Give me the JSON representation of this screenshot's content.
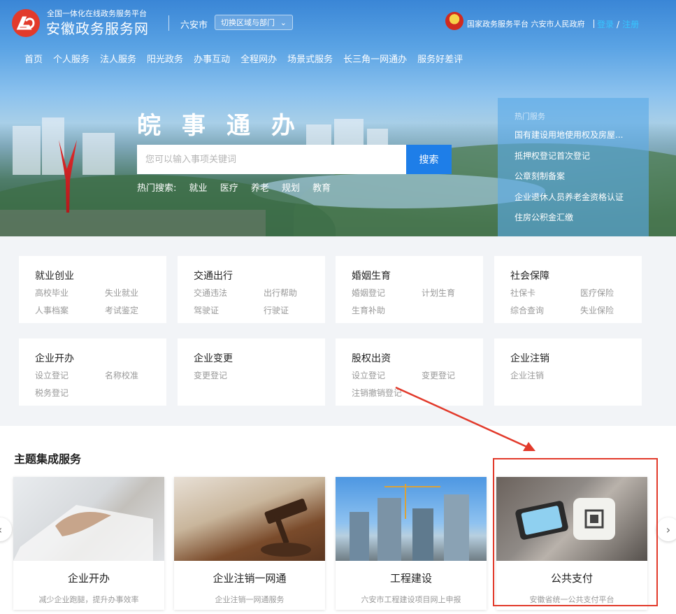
{
  "header": {
    "logo_glyph": "ଏ",
    "logo_subtitle": "全国一体化在线政务服务平台",
    "logo_title": "安徽政务服务网",
    "city": "六安市",
    "region_switch": "切换区域与部门",
    "gov_links": "国家政务服务平台 六安市人民政府",
    "login": "登录",
    "auth_sep": "/",
    "register": "注册"
  },
  "nav": [
    "首页",
    "个人服务",
    "法人服务",
    "阳光政务",
    "办事互动",
    "全程网办",
    "场景式服务",
    "长三角一网通办",
    "服务好差评"
  ],
  "search": {
    "slogan": "皖事通办",
    "placeholder": "您可以输入事项关键词",
    "button": "搜索",
    "hot_label": "热门搜索:",
    "hot_keywords": [
      "就业",
      "医疗",
      "养老",
      "规划",
      "教育"
    ]
  },
  "hot_services": {
    "title": "热门服务",
    "items": [
      "国有建设用地使用权及房屋...",
      "抵押权登记首次登记",
      "公章刻制备案",
      "企业退休人员养老金资格认证",
      "住房公积金汇缴"
    ]
  },
  "categories": [
    {
      "title": "就业创业",
      "links": [
        "高校毕业",
        "失业就业",
        "人事档案",
        "考试鉴定"
      ]
    },
    {
      "title": "交通出行",
      "links": [
        "交通违法",
        "出行帮助",
        "驾驶证",
        "行驶证"
      ]
    },
    {
      "title": "婚姻生育",
      "links": [
        "婚姻登记",
        "计划生育",
        "生育补助"
      ]
    },
    {
      "title": "社会保障",
      "links": [
        "社保卡",
        "医疗保险",
        "综合查询",
        "失业保险"
      ]
    },
    {
      "title": "企业开办",
      "links": [
        "设立登记",
        "名称校准",
        "税务登记"
      ]
    },
    {
      "title": "企业变更",
      "links": [
        "变更登记"
      ]
    },
    {
      "title": "股权出资",
      "links": [
        "设立登记",
        "变更登记",
        "注销撤销登记"
      ]
    },
    {
      "title": "企业注销",
      "links": [
        "企业注销"
      ]
    }
  ],
  "topic": {
    "title": "主题集成服务",
    "cards": [
      {
        "title": "企业开办",
        "subtitle": "减少企业跑腿，提升办事效率"
      },
      {
        "title": "企业注销一网通",
        "subtitle": "企业注销一网通服务"
      },
      {
        "title": "工程建设",
        "subtitle": "六安市工程建设项目网上申报"
      },
      {
        "title": "公共支付",
        "subtitle": "安徽省统一公共支付平台"
      }
    ],
    "prev_icon": "chevron-left-icon",
    "next_icon": "chevron-right-icon"
  },
  "colors": {
    "accent": "#1e7ee8",
    "highlight": "#e23a2b",
    "auth_link": "#37c6ff"
  }
}
